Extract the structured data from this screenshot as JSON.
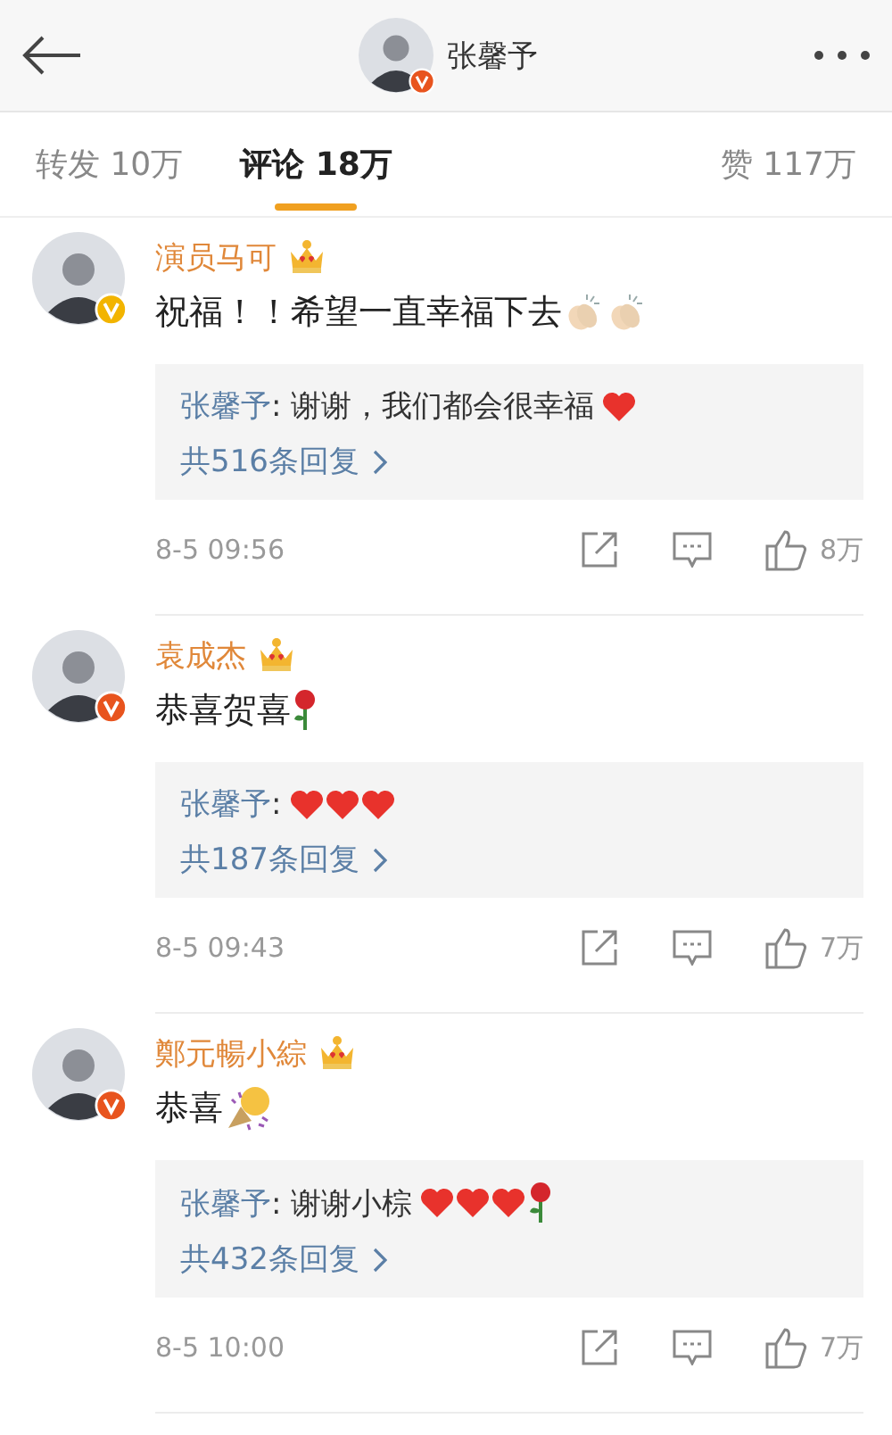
{
  "header": {
    "title": "张馨予",
    "badge": {
      "color": "#e8541e"
    }
  },
  "tabs": [
    {
      "label": "转发 10万",
      "selected": false
    },
    {
      "label": "评论 18万",
      "selected": true
    },
    {
      "label": "赞 117万",
      "selected": false
    }
  ],
  "comments": [
    {
      "name": "演员马可",
      "badge": {
        "color": "#f2b400"
      },
      "text": "祝福！！希望一直幸福下去",
      "emojis": [
        {
          "kind": "clap"
        },
        {
          "kind": "clap"
        }
      ],
      "reply": {
        "author": "张馨予",
        "text": ": 谢谢，我们都会很幸福",
        "emojis": [
          {
            "kind": "heart"
          }
        ]
      },
      "reply_count": "共516条回复",
      "time": "8-5 09:56",
      "likes": "8万"
    },
    {
      "name": "袁成杰",
      "badge": {
        "color": "#e8541e"
      },
      "text": "恭喜贺喜",
      "emojis": [
        {
          "kind": "rose"
        }
      ],
      "reply": {
        "author": "张馨予",
        "text": ":",
        "emojis": [
          {
            "kind": "heart"
          },
          {
            "kind": "heart"
          },
          {
            "kind": "heart"
          }
        ]
      },
      "reply_count": "共187条回复",
      "time": "8-5 09:43",
      "likes": "7万"
    },
    {
      "name": "鄭元暢小綜",
      "badge": {
        "color": "#e8541e"
      },
      "text": "恭喜",
      "emojis": [
        {
          "kind": "confetti"
        }
      ],
      "reply": {
        "author": "张馨予",
        "text": ": 谢谢小棕",
        "emojis": [
          {
            "kind": "heart"
          },
          {
            "kind": "heart"
          },
          {
            "kind": "heart"
          },
          {
            "kind": "rose"
          }
        ]
      },
      "reply_count": "共432条回复",
      "time": "8-5 10:00",
      "likes": "7万"
    }
  ]
}
